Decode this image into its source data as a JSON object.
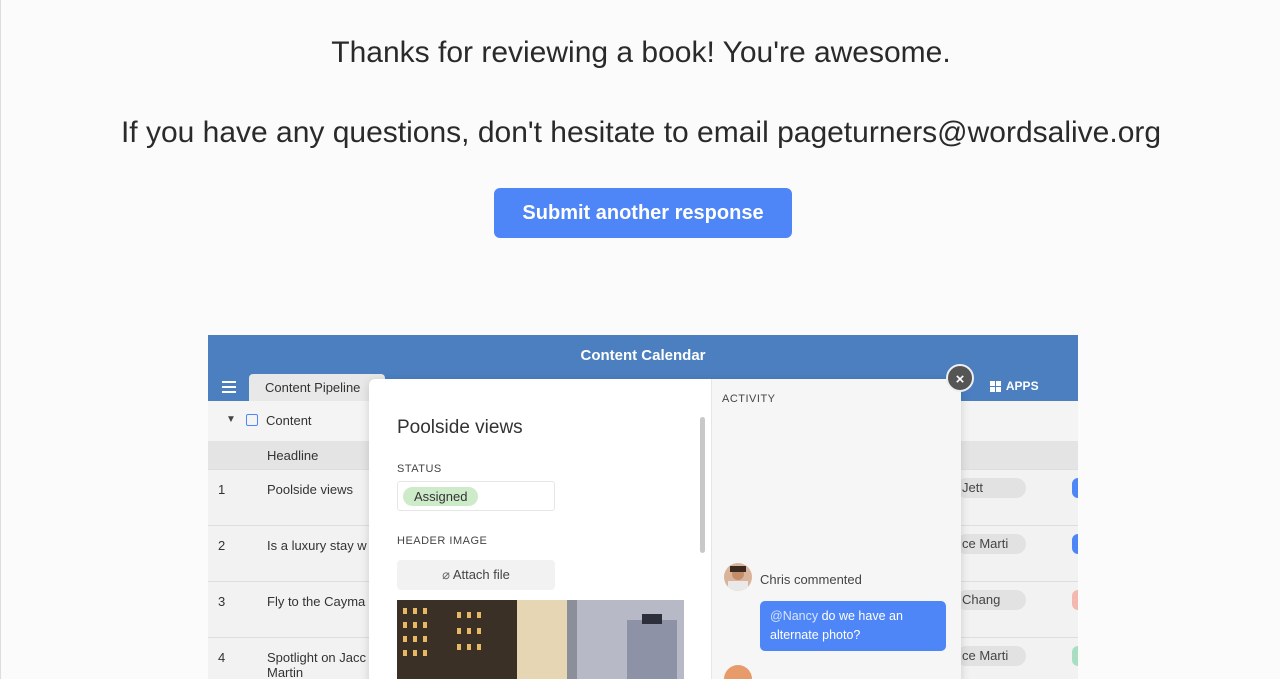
{
  "message": {
    "thanks": "Thanks for reviewing a book! You're awesome.",
    "questions": "If you have any questions, don't hesitate to email pageturners@wordsalive.org",
    "submit_label": "Submit another response"
  },
  "preview": {
    "app_title": "Content Calendar",
    "tab_label": "Content Pipeline",
    "apps_label": "APPS",
    "table_name": "Content",
    "column_header": "Headline",
    "rows": [
      {
        "num": "1",
        "headline": "Poolside views",
        "person": "Jett"
      },
      {
        "num": "2",
        "headline": "Is a luxury stay w",
        "person": "ce Marti"
      },
      {
        "num": "3",
        "headline": "Fly to the Cayma",
        "person": "Chang"
      },
      {
        "num": "4",
        "headline": "Spotlight on Jacc",
        "headline2": "Martin",
        "person": "ce Marti"
      }
    ],
    "record": {
      "title": "Poolside views",
      "status_label": "STATUS",
      "status_value": "Assigned",
      "header_image_label": "HEADER IMAGE",
      "attach_label": "Attach file",
      "activity_label": "ACTIVITY",
      "comment_author": "Chris commented",
      "comment_mention": "@Nancy",
      "comment_text": " do we have an alternate photo?"
    },
    "close_glyph": "×"
  },
  "colors": {
    "accent": "#4f86f7",
    "header_bar": "#4b7fc0",
    "status_green": "#cdebc9"
  }
}
